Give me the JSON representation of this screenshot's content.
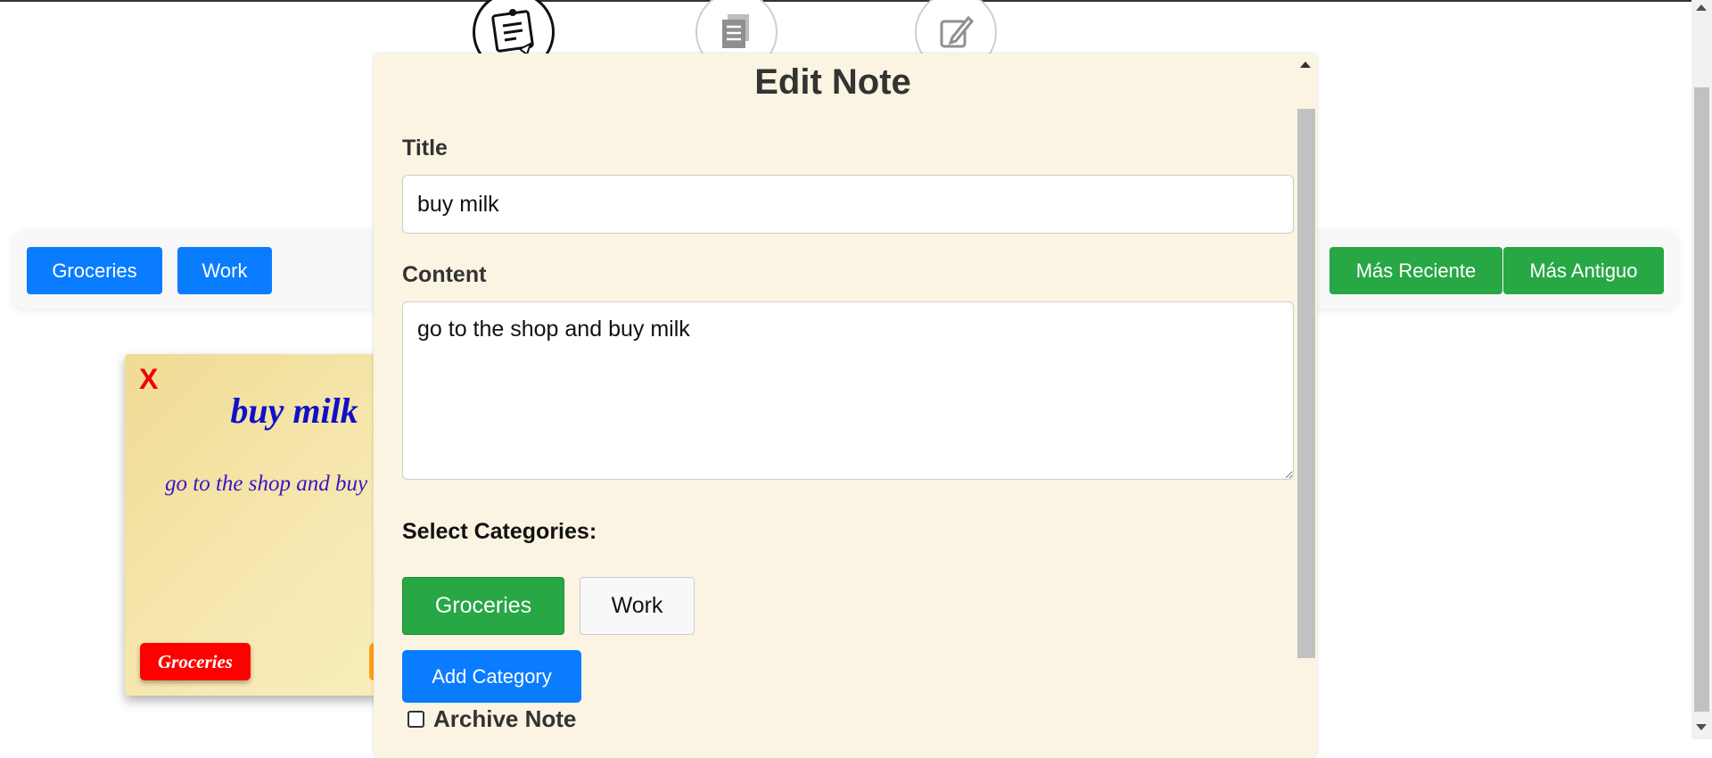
{
  "nav": {
    "icons": [
      "sticky-note-icon",
      "documents-icon",
      "edit-icon"
    ],
    "active": "sticky-note-icon"
  },
  "filters": {
    "categories": [
      "Groceries",
      "Work"
    ],
    "sort": [
      "Más Reciente",
      "Más Antiguo"
    ]
  },
  "note_card": {
    "close": "X",
    "title": "buy milk",
    "content": "go to the shop and buy milk",
    "tag": "Groceries"
  },
  "modal": {
    "heading": "Edit Note",
    "title_label": "Title",
    "title_value": "buy milk",
    "content_label": "Content",
    "content_value": "go to the shop and buy milk",
    "categories_label": "Select Categories:",
    "categories": [
      {
        "label": "Groceries",
        "selected": true
      },
      {
        "label": "Work",
        "selected": false
      }
    ],
    "add_category": "Add Category",
    "archive_label": "Archive Note",
    "archive_checked": false
  },
  "colors": {
    "primary_blue": "#0a7cff",
    "success_green": "#28a745",
    "danger_red": "#ff0000",
    "modal_bg": "#fbf4e2"
  }
}
